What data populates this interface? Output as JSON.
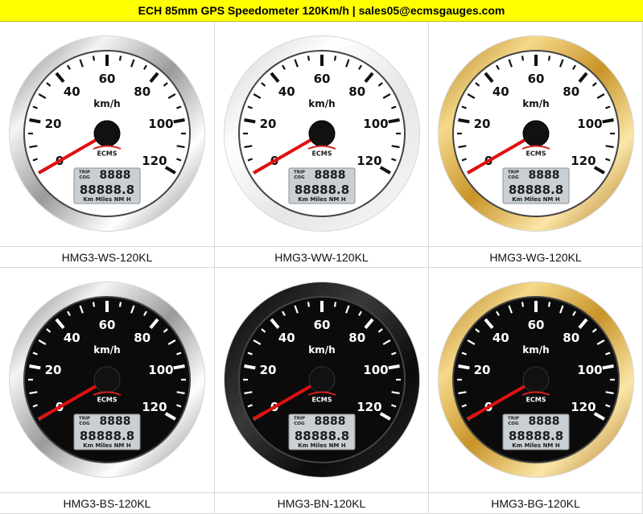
{
  "header": {
    "title": "ECH 85mm GPS Speedometer 120Km/h | sales05@ecmsgauges.com"
  },
  "gauge_face": {
    "unit": "km/h",
    "scale_labels": [
      "0",
      "20",
      "40",
      "60",
      "80",
      "100",
      "120"
    ],
    "brand": "ECMS",
    "lcd_tag_1": "TRIP",
    "lcd_tag_2": "COG",
    "lcd_top": "8888",
    "lcd_bottom": "88888.8",
    "lcd_units": "Km Miles NM H"
  },
  "products": [
    {
      "model": "HMG3-WS-120KL",
      "dial": "white",
      "bezel": "stainless"
    },
    {
      "model": "HMG3-WW-120KL",
      "dial": "white",
      "bezel": "white"
    },
    {
      "model": "HMG3-WG-120KL",
      "dial": "white",
      "bezel": "gold"
    },
    {
      "model": "HMG3-BS-120KL",
      "dial": "black",
      "bezel": "stainless"
    },
    {
      "model": "HMG3-BN-120KL",
      "dial": "black",
      "bezel": "black"
    },
    {
      "model": "HMG3-BG-120KL",
      "dial": "black",
      "bezel": "gold"
    }
  ],
  "colors": {
    "header_bg": "#ffff00",
    "needle": "#e01010",
    "lcd_bg": "#c9cfd3",
    "brand_red": "#d42020"
  }
}
